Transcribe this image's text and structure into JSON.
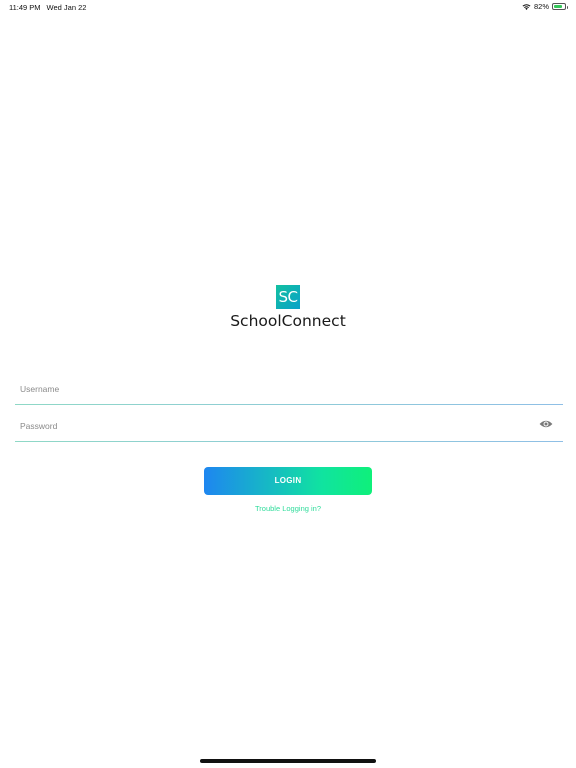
{
  "status_bar": {
    "time": "11:49 PM",
    "date": "Wed Jan 22",
    "battery_percent": "82%",
    "battery_level": 0.82
  },
  "app": {
    "logo_text": "SC",
    "name": "SchoolConnect"
  },
  "form": {
    "username_placeholder": "Username",
    "username_value": "",
    "password_placeholder": "Password",
    "password_value": "",
    "login_label": "LOGIN",
    "trouble_label": "Trouble Logging in?"
  },
  "colors": {
    "accent_blue": "#1e86f0",
    "accent_green": "#10e3a0",
    "link_green": "#2fdc9b"
  }
}
